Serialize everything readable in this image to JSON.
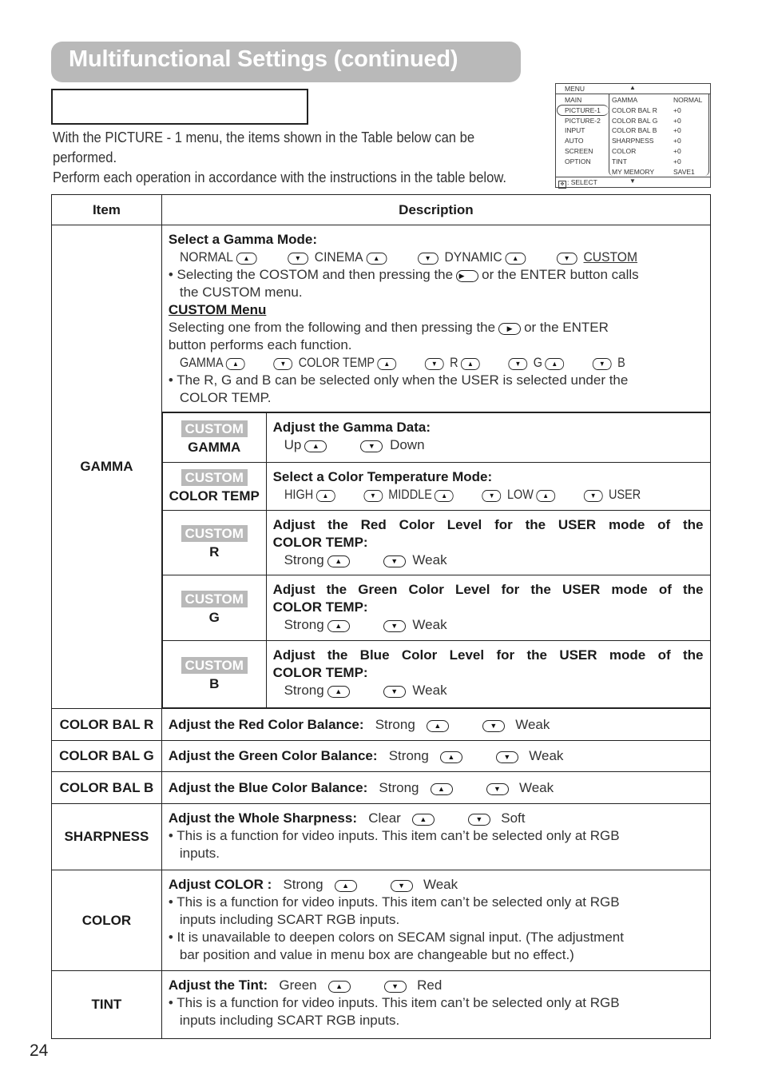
{
  "page": {
    "title": "Multifunctional Settings (continued)",
    "intro_line1": "With the PICTURE - 1 menu, the items shown in the Table below can be",
    "intro_line2": "performed.",
    "intro_line3": "Perform each operation in accordance with the instructions in the table below.",
    "page_number": "24"
  },
  "menu": {
    "header": "MENU",
    "footer": ": SELECT",
    "left_items": [
      "MAIN",
      "PICTURE-1",
      "PICTURE-2",
      "INPUT",
      "AUTO",
      "SCREEN",
      "OPTION"
    ],
    "selected": "PICTURE-1",
    "rows": [
      {
        "name": "GAMMA",
        "value": "NORMAL"
      },
      {
        "name": "COLOR BAL R",
        "value": "+0"
      },
      {
        "name": "COLOR BAL G",
        "value": "+0"
      },
      {
        "name": "COLOR BAL B",
        "value": "+0"
      },
      {
        "name": "SHARPNESS",
        "value": "+0"
      },
      {
        "name": "COLOR",
        "value": "+0"
      },
      {
        "name": "TINT",
        "value": "+0"
      },
      {
        "name": "MY MEMORY",
        "value": "SAVE1"
      }
    ]
  },
  "icons": {
    "up": "▲",
    "down": "▼",
    "right": "▶",
    "select": "✥",
    "menu_up": "▲",
    "menu_down": "▼"
  },
  "table": {
    "col_item": "Item",
    "col_desc": "Description",
    "gamma": {
      "item": "GAMMA",
      "heading": "Select a Gamma Mode:",
      "modes": [
        "NORMAL",
        "CINEMA",
        "DYNAMIC",
        "CUSTOM"
      ],
      "note1a": "• Selecting the COSTOM and then pressing the",
      "note1b": "or the ENTER button calls",
      "note1c": "the CUSTOM menu.",
      "custom_heading": "CUSTOM Menu",
      "custom_text1a": "Selecting one from the following and then pressing the",
      "custom_text1b": "or the ENTER",
      "custom_text2": "button performs each function.",
      "custom_items": [
        "GAMMA",
        "COLOR TEMP",
        "R",
        "G",
        "B"
      ],
      "note2a": "• The R, G and B can be selected only when the USER is selected under the",
      "note2b": "COLOR TEMP.",
      "badge": "CUSTOM",
      "sub": [
        {
          "label": "GAMMA",
          "heading": "Adjust the Gamma Data:",
          "from": "Up",
          "to": "Down"
        },
        {
          "label": "COLOR TEMP",
          "heading": "Select a Color Temperature Mode:",
          "modes": [
            "HIGH",
            "MIDDLE",
            "LOW",
            "USER"
          ]
        },
        {
          "label": "R",
          "heading1": "Adjust the Red Color Level for the USER mode of the",
          "heading2": "COLOR TEMP:",
          "from": "Strong",
          "to": "Weak"
        },
        {
          "label": "G",
          "heading1": "Adjust the Green Color Level for the USER mode of the",
          "heading2": "COLOR TEMP:",
          "from": "Strong",
          "to": "Weak"
        },
        {
          "label": "B",
          "heading1": "Adjust the Blue Color Level for the USER mode of the",
          "heading2": "COLOR TEMP:",
          "from": "Strong",
          "to": "Weak"
        }
      ]
    },
    "rows": [
      {
        "item": "COLOR BAL R",
        "heading": "Adjust the Red Color Balance:",
        "from": "Strong",
        "to": "Weak"
      },
      {
        "item": "COLOR BAL G",
        "heading": "Adjust the Green Color Balance:",
        "from": "Strong",
        "to": "Weak"
      },
      {
        "item": "COLOR BAL B",
        "heading": "Adjust the Blue Color Balance:",
        "from": "Strong",
        "to": "Weak"
      },
      {
        "item": "SHARPNESS",
        "heading": "Adjust the Whole Sharpness:",
        "from": "Clear",
        "to": "Soft",
        "notes": [
          "• This is a function for video inputs. This item can’t be selected only at RGB",
          "inputs."
        ]
      },
      {
        "item": "COLOR",
        "heading": "Adjust COLOR :",
        "from": "Strong",
        "to": "Weak",
        "notes": [
          "• This is a function for video inputs. This item can’t be selected only at  RGB",
          "inputs including SCART RGB inputs.",
          "• It is unavailable to deepen colors on SECAM signal input. (The adjustment",
          "bar position and value in menu box are changeable but no effect.)"
        ]
      },
      {
        "item": "TINT",
        "heading": "Adjust the Tint:",
        "from": "Green",
        "to": "Red",
        "notes": [
          "•  This is a function for video inputs. This item can’t be selected only at  RGB",
          "inputs including SCART RGB inputs."
        ]
      }
    ]
  }
}
